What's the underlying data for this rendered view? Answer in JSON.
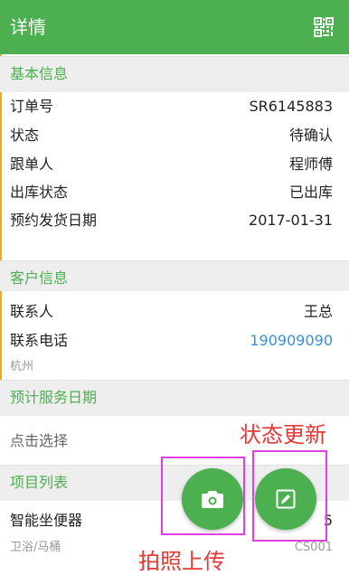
{
  "header": {
    "title": "详情",
    "qr_icon": "qr-code-icon",
    "bg_color": "#4caf50"
  },
  "basic_info": {
    "title": "基本信息",
    "rows": [
      {
        "label": "订单号",
        "value": "SR6145883"
      },
      {
        "label": "状态",
        "value": "待确认"
      },
      {
        "label": "跟单人",
        "value": "程师傅"
      },
      {
        "label": "出库状态",
        "value": "已出库"
      },
      {
        "label": "预约发货日期",
        "value": "2017-01-31"
      }
    ]
  },
  "customer_info": {
    "title": "客户信息",
    "contact_label": "联系人",
    "contact_value": "王总",
    "phone_label": "联系电话",
    "phone_value": "190909090",
    "address": "杭州",
    "phone_color": "#3a8fd6"
  },
  "service_date": {
    "title": "预计服务日期",
    "placeholder": "点击选择"
  },
  "items": {
    "title": "项目列表",
    "list": [
      {
        "name": "智能坐便器",
        "category": "卫浴/马桶",
        "code": "CS001",
        "quantity": "5"
      }
    ]
  },
  "fabs": {
    "camera_icon": "camera-icon",
    "edit_icon": "edit-icon"
  },
  "annotations": {
    "status_update": "状态更新",
    "photo_upload": "拍照上传",
    "box_color": "#e040e0",
    "text_color": "#e53935"
  },
  "colors": {
    "accent_green": "#4caf50",
    "accent_orange": "#f5a623",
    "section_bg": "#eeeeee"
  }
}
